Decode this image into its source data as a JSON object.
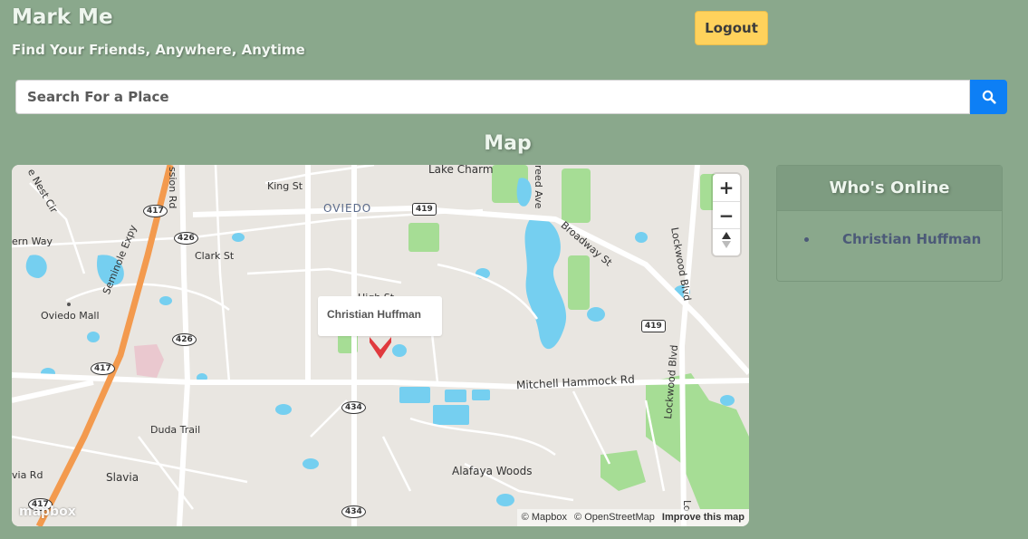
{
  "header": {
    "title": "Mark Me",
    "tagline": "Find Your Friends, Anywhere, Anytime",
    "logout_label": "Logout"
  },
  "search": {
    "placeholder": "Search For a Place",
    "button_icon": "search-icon"
  },
  "map_section": {
    "title": "Map",
    "popup_name": "Christian Huffman",
    "marker_icon": "heart-marker-icon",
    "labels": {
      "lake_charm": "Lake Charm",
      "oviedo": "OVIEDO",
      "king_st": "King St",
      "clark_st": "Clark St",
      "high_st": "High St",
      "oviedo_mall": "Oviedo Mall",
      "seminole_expy": "Seminole Expy",
      "broadway_st": "Broadway St",
      "lockwood_blvd_1": "Lockwood Blvd",
      "lockwood_blvd_2": "Lockwood Blvd",
      "mitchell_hammock": "Mitchell Hammock Rd",
      "duda_trail": "Duda Trail",
      "alafaya_woods": "Alafaya Woods",
      "slavia": "Slavia",
      "ern_way": "ern Way",
      "via_rd": "via Rd",
      "nest_cir": "e Nest Cir",
      "ssion_rd": "ssion Rd",
      "reed_ave": "reed Ave",
      "lo_partial": "Lo"
    },
    "shields": {
      "r417_a": "417",
      "r417_b": "417",
      "r417_c": "417",
      "r426_a": "426",
      "r426_b": "426",
      "r419_a": "419",
      "r419_b": "419",
      "r434_a": "434",
      "r434_b": "434"
    },
    "controls": {
      "zoom_in": "+",
      "zoom_out": "−",
      "compass": "compass-icon"
    },
    "attribution": {
      "mapbox": "© Mapbox",
      "osm": "© OpenStreetMap",
      "improve": "Improve this map"
    },
    "logo": "mapbox",
    "colors": {
      "land": "#e9e6e1",
      "water": "#75cff0",
      "park": "#a6dd95",
      "road": "#ffffff",
      "highway": "#f39a4e",
      "marker": "#e03a3e"
    }
  },
  "online_panel": {
    "title": "Who's Online",
    "users": [
      "Christian Huffman"
    ]
  },
  "colors": {
    "page_bg": "#8aa88c",
    "logout_bg": "#ffd25c",
    "search_button_bg": "#0d7ff5",
    "user_name": "#4c5a78"
  }
}
